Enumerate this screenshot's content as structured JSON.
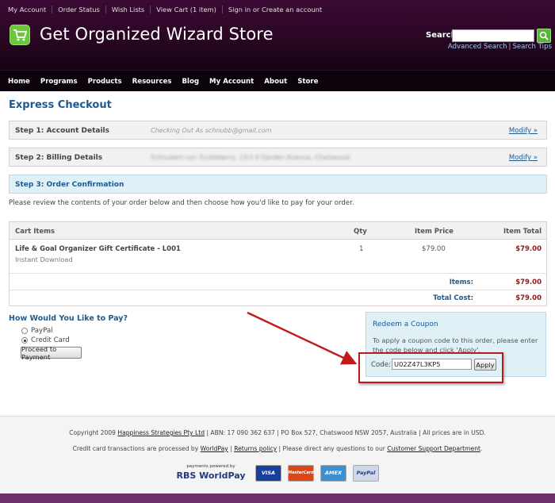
{
  "top_links": [
    "My Account",
    "Order Status",
    "Wish Lists",
    "View Cart (1 item)",
    "Sign in or Create an account"
  ],
  "store_title": "Get Organized Wizard Store",
  "search": {
    "label": "Search",
    "value": "",
    "advanced": "Advanced Search",
    "separator": "|",
    "tips": "Search Tips"
  },
  "nav": [
    "Home",
    "Programs",
    "Products",
    "Resources",
    "Blog",
    "My Account",
    "About",
    "Store"
  ],
  "page_title": "Express Checkout",
  "steps": [
    {
      "label": "Step 1: Account Details",
      "detail": "Checking Out As schnubb@gmail.com",
      "modify": "Modify »"
    },
    {
      "label": "Step 2: Billing Details",
      "detail": "Schnubert von Turbleberry, 15/3 9 Garden Avenue, Chatswood",
      "modify": "Modify »"
    },
    {
      "label": "Step 3: Order Confirmation"
    }
  ],
  "intro": "Please review the contents of your order below and then choose how you'd like to pay for your order.",
  "cart": {
    "headers": {
      "items": "Cart Items",
      "qty": "Qty",
      "price": "Item Price",
      "total": "Item Total"
    },
    "rows": [
      {
        "name": "Life & Goal Organizer Gift Certificate - L001",
        "sub": "Instant Download",
        "qty": "1",
        "price": "$79.00",
        "total": "$79.00"
      }
    ],
    "items_label": "Items:",
    "items_value": "$79.00",
    "total_label": "Total Cost:",
    "total_value": "$79.00"
  },
  "payment": {
    "title": "How Would You Like to Pay?",
    "options": [
      "PayPal",
      "Credit Card"
    ],
    "selected": "Credit Card",
    "proceed": "Proceed to Payment"
  },
  "coupon": {
    "title": "Redeem a Coupon",
    "description": "To apply a coupon code to this order, please enter the code below and click 'Apply'.",
    "code_label": "Code:",
    "code_value": "U02Z47L3KP5",
    "apply": "Apply"
  },
  "footer": {
    "copyright_pre": "Copyright 2009 ",
    "company": "Happiness Strategies Pty Ltd",
    "copyright_post": " | ABN: 17 090 362 637 | PO Box 527, Chatswood NSW 2057, Australia | All prices are in USD.",
    "processed_pre": "Credit card transactions are processed by ",
    "worldpay_link": "WorldPay",
    "sep1": " | ",
    "returns_link": "Returns policy",
    "processed_mid": " | Please direct any questions to our ",
    "support_link": "Customer Support Department",
    "processed_end": ".",
    "powered": "payments powered by",
    "worldpay_logo": "RBS WorldPay",
    "cards": [
      "VISA",
      "MasterCard",
      "AMEX",
      "PayPal"
    ]
  },
  "colors": {
    "accent": "#1d5a8f",
    "price": "#8b1a1a",
    "highlight": "#b81d1d",
    "brand_bg": "#2a0724",
    "frame": "#6e2f6a"
  }
}
